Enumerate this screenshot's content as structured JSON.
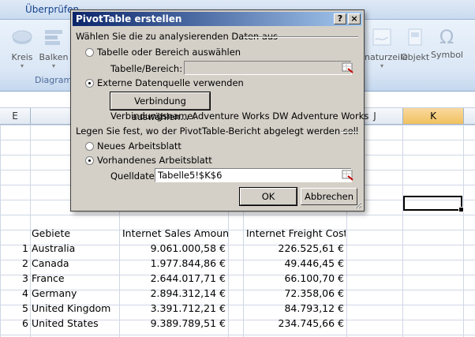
{
  "ribbon": {
    "tab_label": "Überprüfen",
    "buttons": {
      "circle": "Kreis",
      "bar": "Balken",
      "signature": "naturzeile",
      "object": "Objekt",
      "symbol": "Symbol"
    },
    "group_label": "Diagramm"
  },
  "columns": {
    "e": "E",
    "j": "J",
    "k": "K"
  },
  "dialog": {
    "title": "PivotTable erstellen",
    "help_button": "?",
    "close_button": "×",
    "section_data": "Wählen Sie die zu analysierenden Daten aus",
    "radio_table_label": "Tabelle oder Bereich auswählen",
    "table_range_label": "Tabelle/Bereich:",
    "table_range_value": "",
    "radio_external_label": "Externe Datenquelle verwenden",
    "choose_connection_button": "Verbindung auswählen...",
    "connection_name_label": "Verbindungsname:",
    "connection_name_value": ". Adventure Works DW Adventure Works",
    "section_location": "Legen Sie fest, wo der PivotTable-Bericht abgelegt werden soll",
    "radio_new_sheet_label": "Neues Arbeitsblatt",
    "radio_existing_sheet_label": "Vorhandenes Arbeitsblatt",
    "source_file_label": "Quelldatei:",
    "source_file_value": "Tabelle5!$K$6",
    "ok_button": "OK",
    "cancel_button": "Abbrechen"
  },
  "table": {
    "headers": [
      "Gebiete",
      "Internet Sales Amount",
      "Internet Freight Cost"
    ],
    "rows": [
      {
        "n": "1",
        "region": "Australia",
        "sales": "9.061.000,58 €",
        "freight": "226.525,61 €"
      },
      {
        "n": "2",
        "region": "Canada",
        "sales": "1.977.844,86 €",
        "freight": "49.446,45 €"
      },
      {
        "n": "3",
        "region": "France",
        "sales": "2.644.017,71 €",
        "freight": "66.100,70 €"
      },
      {
        "n": "4",
        "region": "Germany",
        "sales": "2.894.312,14 €",
        "freight": "72.358,06 €"
      },
      {
        "n": "5",
        "region": "United Kingdom",
        "sales": "3.391.712,21 €",
        "freight": "84.793,12 €"
      },
      {
        "n": "6",
        "region": "United States",
        "sales": "9.389.789,51 €",
        "freight": "234.745,66 €"
      }
    ]
  }
}
